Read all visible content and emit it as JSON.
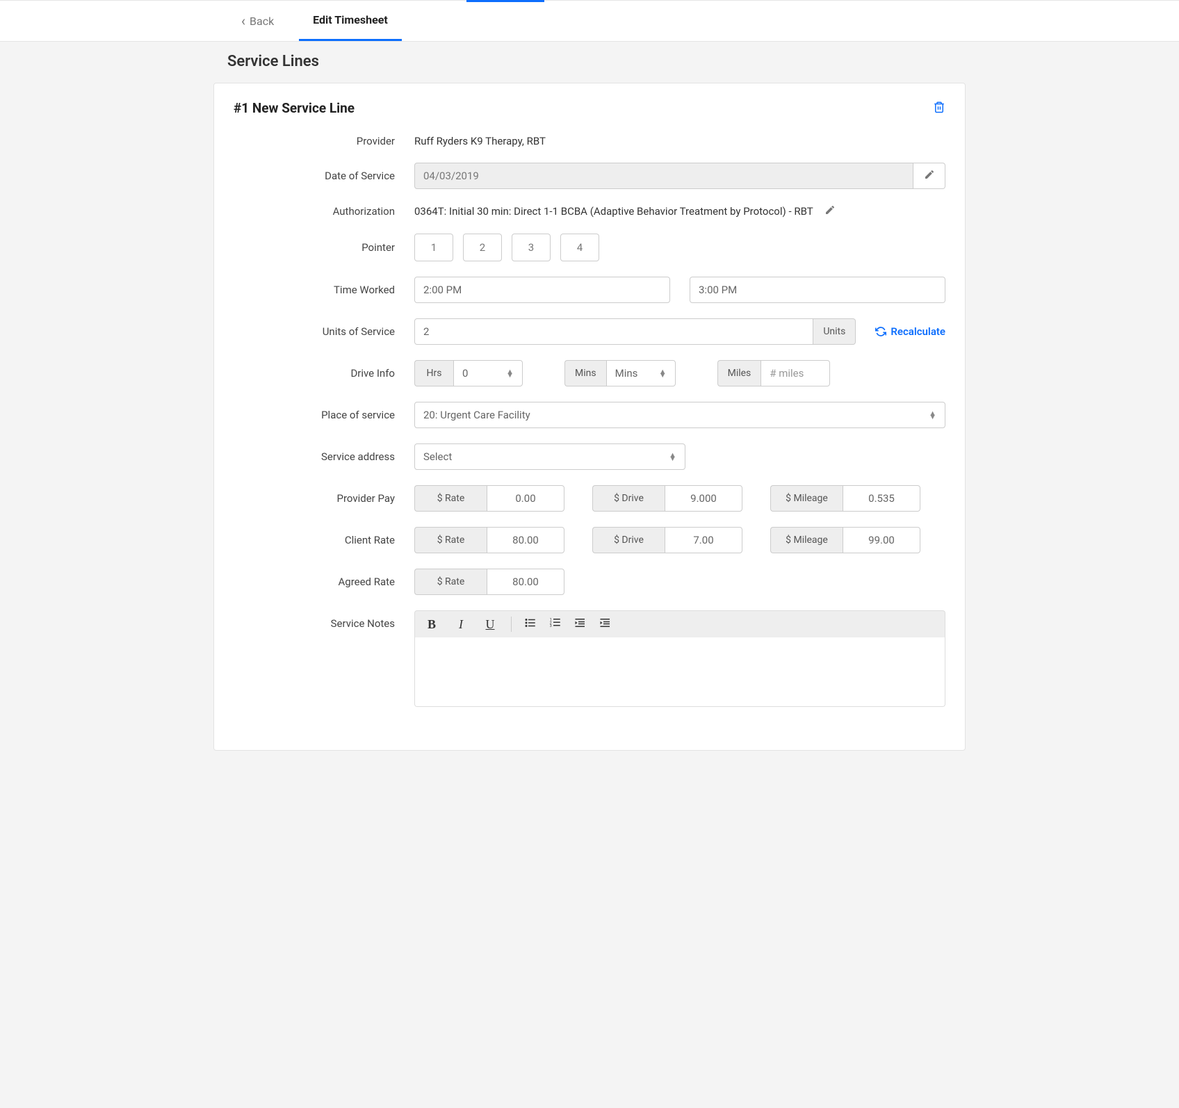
{
  "nav": {
    "back": "Back",
    "tab": "Edit Timesheet"
  },
  "page_title": "Service Lines",
  "card": {
    "title": "#1 New Service Line",
    "labels": {
      "provider": "Provider",
      "date_of_service": "Date of Service",
      "authorization": "Authorization",
      "pointer": "Pointer",
      "time_worked": "Time Worked",
      "units_of_service": "Units of Service",
      "drive_info": "Drive Info",
      "place_of_service": "Place of service",
      "service_address": "Service address",
      "provider_pay": "Provider Pay",
      "client_rate": "Client Rate",
      "agreed_rate": "Agreed Rate",
      "service_notes": "Service Notes"
    },
    "provider_value": "Ruff Ryders K9 Therapy, RBT",
    "date_value": "04/03/2019",
    "authorization_value": "0364T: Initial 30 min: Direct 1-1 BCBA (Adaptive Behavior Treatment by Protocol) - RBT",
    "pointer_values": [
      "1",
      "2",
      "3",
      "4"
    ],
    "time_start": "2:00 PM",
    "time_end": "3:00 PM",
    "units_value": "2",
    "units_label": "Units",
    "recalculate": "Recalculate",
    "drive": {
      "hrs_label": "Hrs",
      "hrs_value": "0",
      "mins_label": "Mins",
      "mins_value": "Mins",
      "miles_label": "Miles",
      "miles_placeholder": "# miles"
    },
    "place_of_service_value": "20: Urgent Care Facility",
    "service_address_value": "Select",
    "pay": {
      "rate_label": "$ Rate",
      "drive_label": "$ Drive",
      "mileage_label": "$ Mileage",
      "provider_rate": "0.00",
      "provider_drive": "9.000",
      "provider_mileage": "0.535",
      "client_rate": "80.00",
      "client_drive": "7.00",
      "client_mileage": "99.00",
      "agreed_rate": "80.00"
    }
  }
}
